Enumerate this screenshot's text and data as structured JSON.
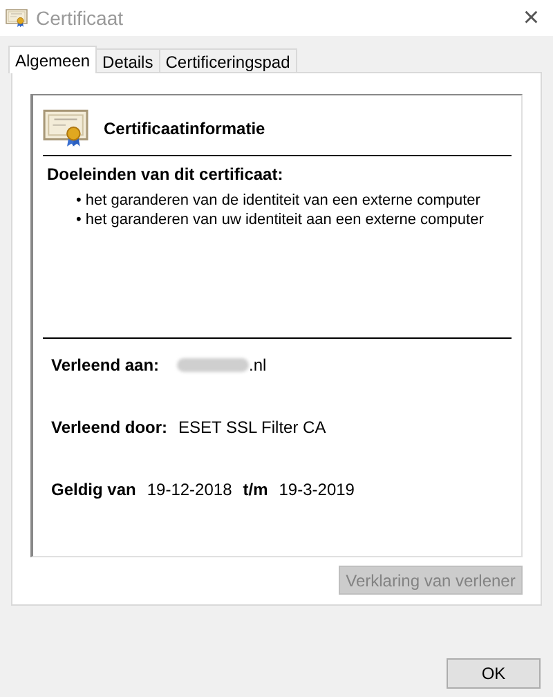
{
  "window": {
    "title": "Certificaat",
    "close": "×"
  },
  "tabs": [
    {
      "label": "Algemeen",
      "selected": true
    },
    {
      "label": "Details",
      "selected": false
    },
    {
      "label": "Certificeringspad",
      "selected": false
    }
  ],
  "info": {
    "title": "Certificaatinformatie",
    "purposes_heading": "Doeleinden van dit certificaat:",
    "purposes": [
      {
        "bullet": "•",
        "text": "het garanderen van de identiteit van een externe computer"
      },
      {
        "bullet": "•",
        "text": "het garanderen van uw identiteit aan een externe computer"
      }
    ],
    "issued_to": {
      "label": "Verleend aan:",
      "value": ".nl",
      "redacted": true
    },
    "issued_by": {
      "label": "Verleend door:",
      "value": "ESET SSL Filter CA"
    },
    "validity": {
      "from_label": "Geldig van",
      "from": "19-12-2018",
      "to_label": "t/m",
      "to": "19-3-2019"
    }
  },
  "issuer_statement_button": {
    "label": "Verklaring van verlener",
    "disabled": true
  },
  "buttons": [
    {
      "label": "OK"
    }
  ]
}
